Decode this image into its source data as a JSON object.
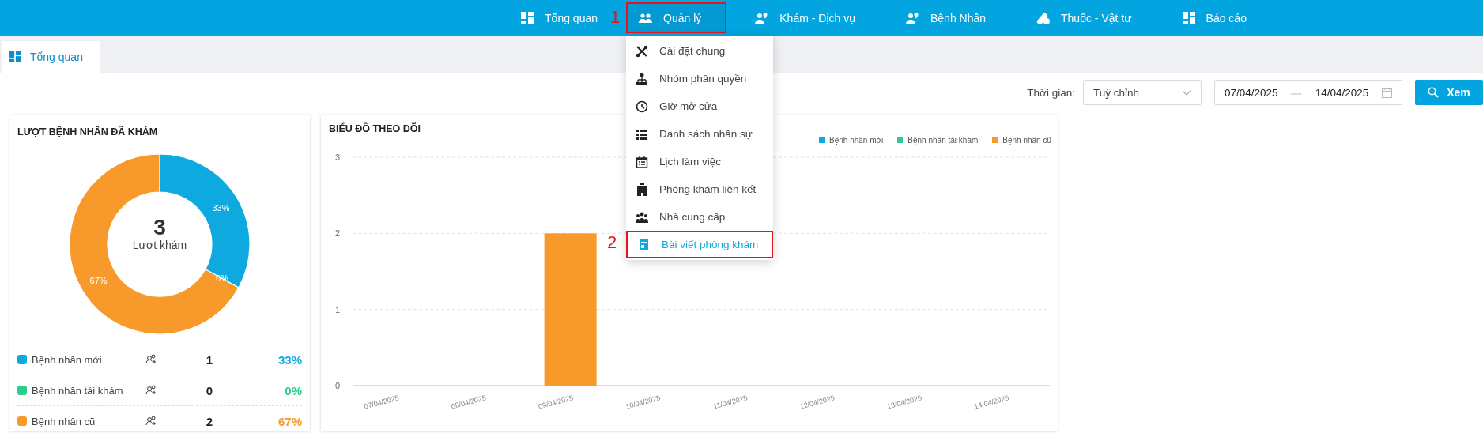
{
  "nav": {
    "items": [
      {
        "label": "Tổng quan",
        "kind": "grid",
        "expanded": false
      },
      {
        "label": "Quản lý",
        "kind": "people",
        "expanded": true,
        "callout": "1"
      },
      {
        "label": "Khám - Dịch vụ",
        "kind": "doctor",
        "expanded": false
      },
      {
        "label": "Bệnh Nhân",
        "kind": "doctor",
        "expanded": false
      },
      {
        "label": "Thuốc - Vật tư",
        "kind": "pills",
        "expanded": false
      },
      {
        "label": "Báo cáo",
        "kind": "grid",
        "expanded": false
      }
    ]
  },
  "menu": {
    "items": [
      {
        "label": "Cài đặt chung",
        "kind": "tools",
        "selected": false
      },
      {
        "label": "Nhóm phân quyền",
        "kind": "hierarchy",
        "selected": false
      },
      {
        "label": "Giờ mở cửa",
        "kind": "clock",
        "selected": false
      },
      {
        "label": "Danh sách nhân sự",
        "kind": "list",
        "selected": false
      },
      {
        "label": "Lịch làm việc",
        "kind": "calendar",
        "selected": false
      },
      {
        "label": "Phòng khám liên kết",
        "kind": "building",
        "selected": false
      },
      {
        "label": "Nhà cung cấp",
        "kind": "people",
        "selected": false
      },
      {
        "label": "Bài viết phòng khám",
        "kind": "article",
        "selected": true,
        "callout": "2"
      }
    ]
  },
  "tabs": [
    {
      "label": "Tổng quan",
      "selected": true
    }
  ],
  "filter": {
    "label": "Thời gian:",
    "period": "Tuỳ chỉnh",
    "date_from": "07/04/2025",
    "date_to": "14/04/2025",
    "button": "Xem"
  },
  "summary_card": {
    "title": "LƯỢT BỆNH NHÂN ĐÃ KHÁM",
    "center_value": "3",
    "center_label": "Lượt khám",
    "chart_data": {
      "type": "donut",
      "values": [
        33,
        0,
        67
      ],
      "value_labels": [
        "33%",
        "0%",
        "67%"
      ]
    },
    "legend": [
      {
        "name": "Bệnh nhân mới",
        "color": "#0eaadf",
        "count": "1",
        "percent": "33%"
      },
      {
        "name": "Bệnh nhân tái khám",
        "color": "#2ecc8a",
        "count": "0",
        "percent": "0%"
      },
      {
        "name": "Bệnh nhân cũ",
        "color": "#f7992b",
        "count": "2",
        "percent": "67%"
      }
    ]
  },
  "trend_card": {
    "title": "BIỂU ĐỒ THEO DÕI",
    "chart_data": {
      "type": "bar",
      "stacked": true,
      "categories": [
        "07/04/2025",
        "08/04/2025",
        "09/04/2025",
        "10/04/2025",
        "11/04/2025",
        "12/04/2025",
        "13/04/2025",
        "14/04/2025"
      ],
      "ylim": [
        0,
        3
      ],
      "yticks": [
        0,
        1,
        2,
        3
      ],
      "series": [
        {
          "name": "Bệnh nhân mới",
          "color": "#0eaadf",
          "values": [
            0,
            0,
            0,
            0,
            0,
            0,
            0,
            0
          ]
        },
        {
          "name": "Bệnh nhân tái khám",
          "color": "#2ecc8a",
          "values": [
            0,
            0,
            0,
            0,
            0,
            0,
            0,
            0
          ]
        },
        {
          "name": "Bệnh nhân cũ",
          "color": "#f7992b",
          "values": [
            0,
            0,
            2,
            0,
            0,
            0,
            0,
            0
          ]
        }
      ]
    }
  }
}
